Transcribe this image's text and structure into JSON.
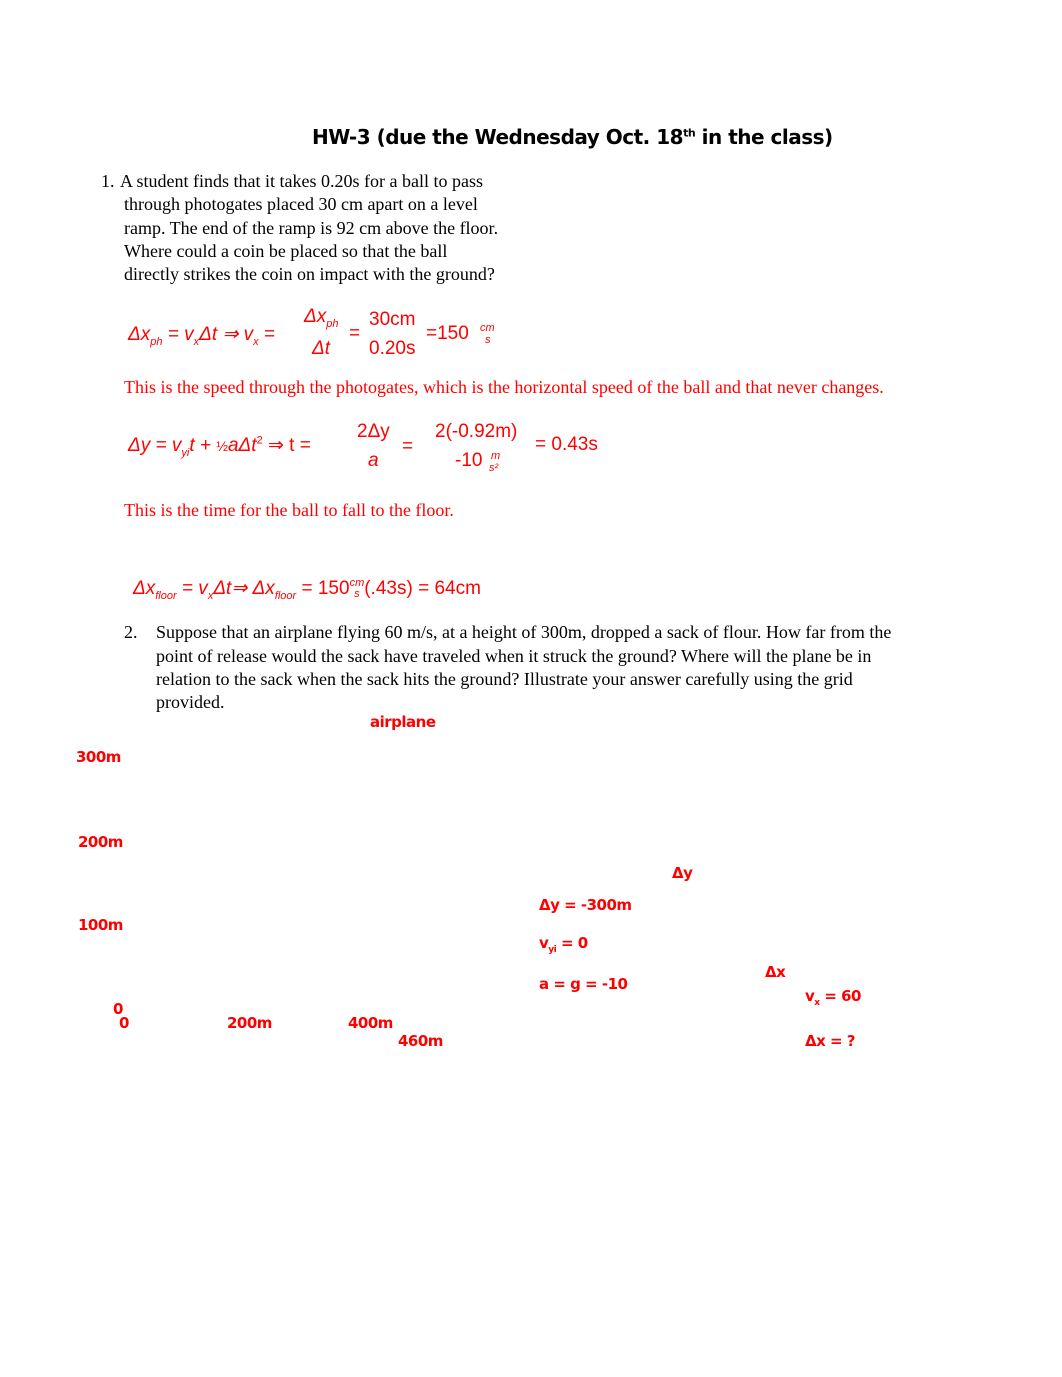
{
  "title": "HW-3  (due the Wednesday Oct. 18",
  "title_sup": "th",
  "title_end": " in the class)",
  "q1": {
    "number": "1.",
    "lines": [
      "A student finds that it takes 0.20s for a ball to pass",
      "through photogates placed 30 cm apart on a level",
      "ramp. The end of the ramp is 92 cm above the floor.",
      "Where could a coin be placed so that the ball",
      "directly strikes the coin on impact with the ground?"
    ]
  },
  "eq1": {
    "lhs": "Δx",
    "lhs_sub": "ph",
    "mid": "= v",
    "mid_sub": "x",
    "mid2": "Δt ⇒ v",
    "mid2_sub": "x",
    "eqs": "=",
    "num1": "Δx",
    "num1_sub": "ph",
    "den1": "Δt",
    "eq2": "=",
    "num2": "30cm",
    "den2": "0.20s",
    "result": "=150",
    "unit_top": "cm",
    "unit_bot": "s"
  },
  "note1": "This is the speed through the photogates, which is the horizontal speed of the ball and that never changes.",
  "eq2": {
    "lhs": "Δy = v",
    "lhs_sub": "yi",
    "mid": "t + ",
    "half": "½",
    "mid2": "aΔt",
    "sq": "2",
    "arrow": " ⇒  t =",
    "num1": "2Δy",
    "den1": "a",
    "eq": "=",
    "num2": "2(-0.92m)",
    "den2": "-10",
    "unit_top": "m",
    "unit_bot": "s²",
    "result": "= 0.43s"
  },
  "note2": "This is the time for the ball to fall to the floor.",
  "eq3": {
    "a": "Δx",
    "a_sub": "floor",
    "b": " = v",
    "b_sub": "x",
    "c": "Δt⇒  Δx",
    "c_sub": "floor",
    "d": " = 150",
    "unit_top": "cm",
    "unit_bot": "s",
    "e": "(.43s) = 64cm"
  },
  "q2": {
    "number": "2.",
    "lines": [
      "Suppose that an airplane flying 60 m/s, at a height of 300m, dropped a sack of flour. How far from the",
      "point of release would the sack have traveled when it struck the ground? Where will the plane be in",
      "relation to the sack when the sack hits the ground? Illustrate your answer carefully using the grid",
      "provided."
    ]
  },
  "grid": {
    "airplane": "airplane",
    "y_labels": [
      "300m",
      "200m",
      "100m",
      "0"
    ],
    "x_labels": [
      "0",
      "200m",
      "400m",
      "460m"
    ]
  },
  "annotations": {
    "dy_label": "Δy",
    "dy": "Δy = -300m",
    "vyi": "v",
    "vyi_sub": "yi",
    "vyi_val": " = 0",
    "a": "a = g = -10",
    "dx_label": "Δx",
    "vx": "v",
    "vx_sub": "x",
    "vx_val": " = 60",
    "dx": "Δx = ?"
  }
}
